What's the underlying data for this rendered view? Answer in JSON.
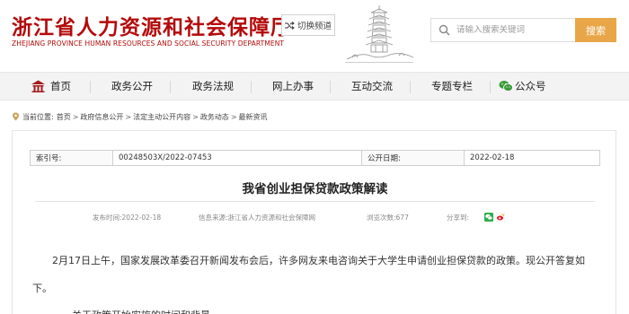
{
  "header": {
    "site_title": "浙江省人力资源和社会保障厅",
    "site_title_en": "ZHEJIANG PROVINCE HUMAN RESOURCES AND SOCIAL SECURITY DEPARTMENT",
    "switch_label": "切换频道",
    "search_placeholder": "请输入搜索关键词",
    "search_button": "搜索",
    "brand_color": "#b40a0a",
    "accent_color": "#e9a649"
  },
  "nav": {
    "items": [
      {
        "label": "首页",
        "icon": "home-icon"
      },
      {
        "label": "政务公开"
      },
      {
        "label": "政务法规"
      },
      {
        "label": "网上办事"
      },
      {
        "label": "互动交流"
      },
      {
        "label": "专题专栏"
      },
      {
        "label": "公众号",
        "icon": "wechat-icon"
      }
    ]
  },
  "breadcrumb": {
    "prefix": "当前位置:",
    "items": [
      "首页",
      "政府信息公开",
      "法定主动公开内容",
      "政务动态",
      "最新资讯"
    ]
  },
  "meta": {
    "index_label": "索引号:",
    "index_value": "00248503X/2022-07453",
    "date_label": "公开日期:",
    "date_value": "2022-02-18"
  },
  "article": {
    "title": "我省创业担保贷款政策解读",
    "publish_time": "发布时间:2022-02-18",
    "source": "信息来源:浙江省人力资源和社会保障网",
    "views": "浏览次数:677",
    "share_label": "分享到:",
    "paragraph1_line1": "2月17日上午，国家发展改革委召开新闻发布会后，许多网友来电咨询关于大学生申请创业担保贷款的政策。现公开答复如",
    "paragraph1_line2": "下。",
    "paragraph2": "一、关于政策开始实施的时间和背景"
  }
}
